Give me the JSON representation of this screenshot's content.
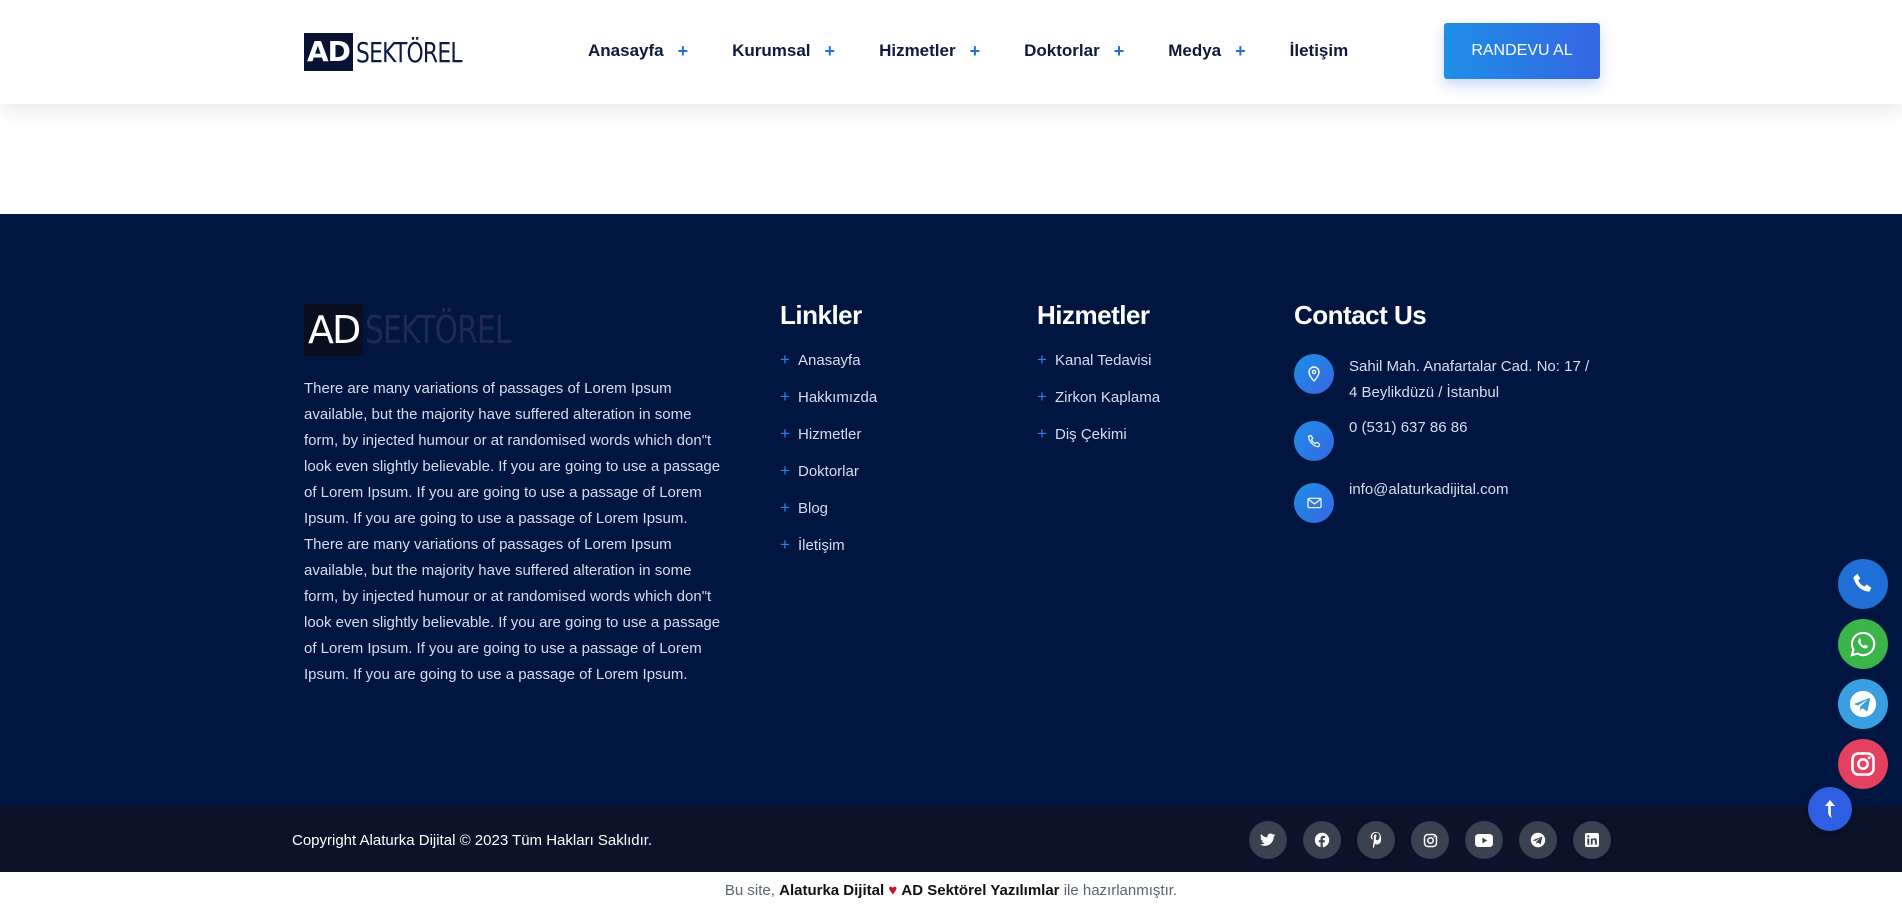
{
  "header": {
    "logo": {
      "ad": "AD",
      "sektorel": "SEKTÖREL"
    },
    "nav": [
      {
        "label": "Anasayfa",
        "plus": "+"
      },
      {
        "label": "Kurumsal",
        "plus": "+"
      },
      {
        "label": "Hizmetler",
        "plus": "+"
      },
      {
        "label": "Doktorlar",
        "plus": "+"
      },
      {
        "label": "Medya",
        "plus": "+"
      },
      {
        "label": "İletişim"
      }
    ],
    "cta_label": "RANDEVU AL"
  },
  "footer": {
    "logo": {
      "ad": "AD",
      "sektorel": "SEKTÖREL"
    },
    "description": "There are many variations of passages of Lorem Ipsum available, but the majority have suffered alteration in some form, by injected humour or at randomised words which don\"t look even slightly believable. If you are going to use a passage of Lorem Ipsum. If you are going to use a passage of Lorem Ipsum. If you are going to use a passage of Lorem Ipsum. There are many variations of passages of Lorem Ipsum available, but the majority have suffered alteration in some form, by injected humour or at randomised words which don\"t look even slightly believable. If you are going to use a passage of Lorem Ipsum. If you are going to use a passage of Lorem Ipsum. If you are going to use a passage of Lorem Ipsum.",
    "links_title": "Linkler",
    "links": [
      "Anasayfa",
      "Hakkımızda",
      "Hizmetler",
      "Doktorlar",
      "Blog",
      "İletişim"
    ],
    "services_title": "Hizmetler",
    "services": [
      "Kanal Tedavisi",
      "Zirkon Kaplama",
      "Diş Çekimi"
    ],
    "contact_title": "Contact Us",
    "contact": {
      "address": "Sahil Mah. Anafartalar Cad. No: 17 / 4 Beylikdüzü / İstanbul",
      "phone": "0 (531) 637 86 86",
      "email": "info@alaturkadijital.com"
    },
    "plus": "+"
  },
  "bottom": {
    "copyright": "Copyright Alaturka Dijital © 2023 Tüm Hakları Saklıdır.",
    "socials": [
      "twitter-icon",
      "facebook-icon",
      "pinterest-icon",
      "instagram-icon",
      "youtube-icon",
      "telegram-icon",
      "linkedin-icon"
    ]
  },
  "credit": {
    "prefix": "Bu site, ",
    "brand1": "Alaturka Dijital",
    "heart": "♥",
    "brand2": "AD Sektörel Yazılımlar",
    "suffix": " ile hazırlanmıştır."
  },
  "floating": [
    "phone-icon",
    "whatsapp-icon",
    "telegram-icon",
    "instagram-icon"
  ],
  "colors": {
    "primary": "#1e8fe6",
    "footer_bg": "#001640",
    "bottom_bg": "#0a1329",
    "whatsapp": "#3bb54a",
    "instagram": "#e4405f"
  }
}
